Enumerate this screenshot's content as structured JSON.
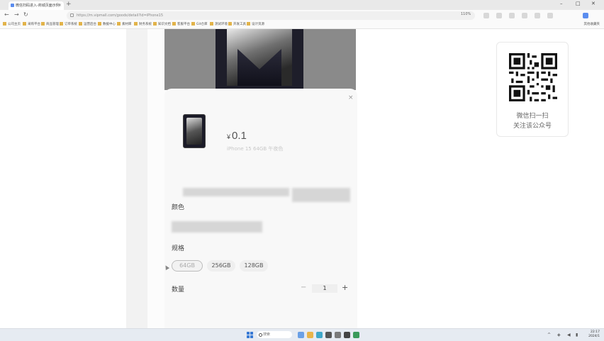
{
  "browser": {
    "tab_title": "微信扫码进入-商城页面示例",
    "new_tab": "+",
    "url": "https://m.vipmall.com/goods/detail?id=iPhone15",
    "zoom": "110%",
    "nav": {
      "back": "←",
      "forward": "→",
      "refresh": "↻"
    },
    "window": {
      "minimize": "–",
      "maximize": "□",
      "close": "✕"
    },
    "bookmarks": [
      "公司主页",
      "采购平台",
      "商品管理",
      "订单系统",
      "运营后台",
      "数据中心",
      "素材库",
      "财务系统",
      "知识文档",
      "客服平台",
      "Git仓库",
      "测试环境",
      "开发工具",
      "设计资源"
    ],
    "bookmarks_right": "其他收藏夹"
  },
  "product": {
    "currency": "¥",
    "price": "0.1",
    "selected_summary": "iPhone 15 64GB 午夜色",
    "close_icon": "×",
    "color_title": "颜色",
    "spec_title": "规格",
    "specs": [
      "64GB",
      "256GB",
      "128GB"
    ],
    "selected_spec": "64GB",
    "qty_title": "数量",
    "qty_minus": "−",
    "qty_value": "1",
    "qty_plus": "+"
  },
  "qr_card": {
    "line1": "微信扫一扫",
    "line2": "关注该公众号"
  },
  "taskbar": {
    "search": "搜索",
    "time": "22:17",
    "date": "2024/1"
  }
}
